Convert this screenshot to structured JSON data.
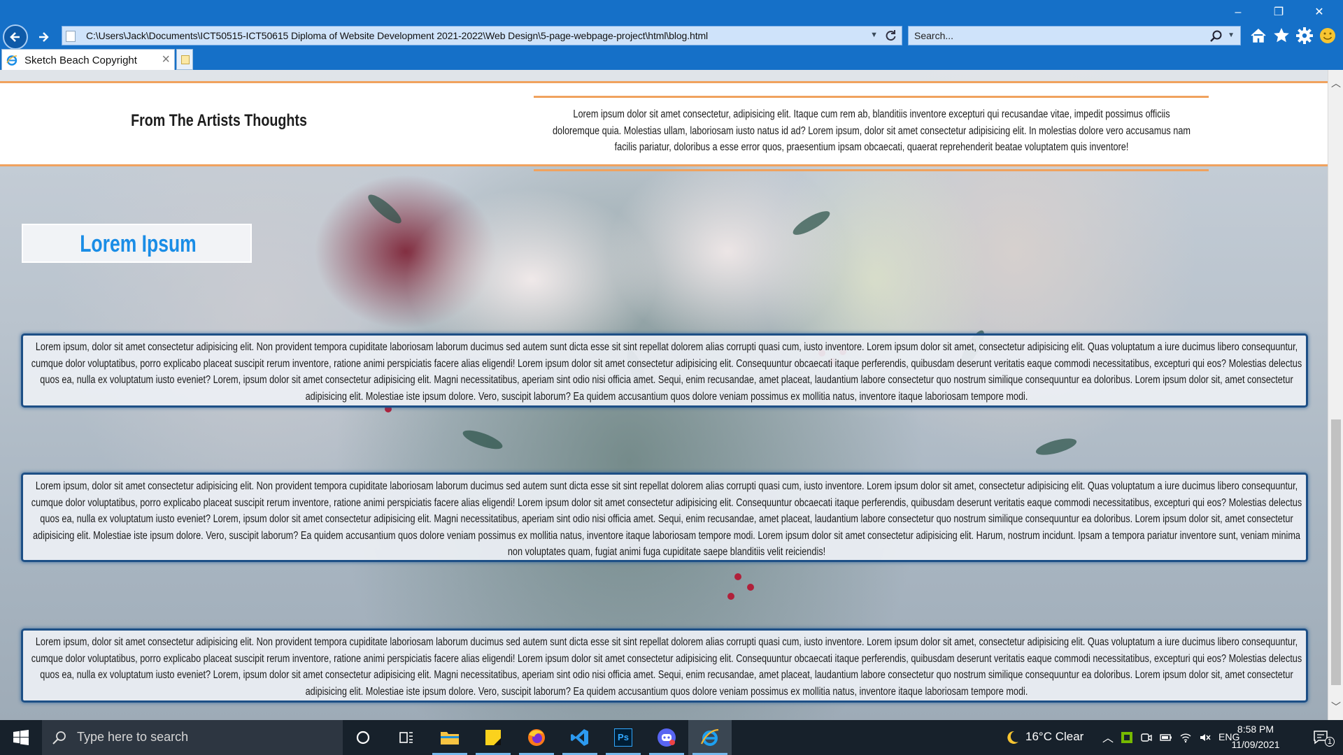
{
  "browser": {
    "address_url": "C:\\Users\\Jack\\Documents\\ICT50515-ICT50615 Diploma of Website Development 2021-2022\\Web Design\\5-page-webpage-project\\html\\blog.html",
    "search_placeholder": "Search...",
    "tab_title": "Sketch Beach Copyright",
    "tab_close": "×",
    "minimize": "–",
    "restore": "❐",
    "close": "✕",
    "dropdown": "▼"
  },
  "page": {
    "artist_heading": "From The Artists Thoughts",
    "artist_text": "Lorem ipsum dolor sit amet consectetur, adipisicing elit. Itaque cum rem ab, blanditiis inventore excepturi qui recusandae vitae, impedit possimus officiis doloremque quia. Molestias ullam, laboriosam iusto natus id ad? Lorem ipsum, dolor sit amet consectetur adipisicing elit. In molestias dolore vero accusamus nam facilis pariatur, doloribus a esse error quos, praesentium ipsam obcaecati, quaerat reprehenderit beatae voluptatem quis inventore!",
    "lorem_heading": "Lorem Ipsum",
    "cards": [
      "Lorem ipsum, dolor sit amet consectetur adipisicing elit. Non provident tempora cupiditate laboriosam laborum ducimus sed autem sunt dicta esse sit sint repellat dolorem alias corrupti quasi cum, iusto inventore. Lorem ipsum dolor sit amet, consectetur adipisicing elit. Quas voluptatum a iure ducimus libero consequuntur, cumque dolor voluptatibus, porro explicabo placeat suscipit rerum inventore, ratione animi perspiciatis facere alias eligendi! Lorem ipsum dolor sit amet consectetur adipisicing elit. Consequuntur obcaecati itaque perferendis, quibusdam deserunt veritatis eaque commodi necessitatibus, excepturi qui eos? Molestias delectus quos ea, nulla ex voluptatum iusto eveniet? Lorem, ipsum dolor sit amet consectetur adipisicing elit. Magni necessitatibus, aperiam sint odio nisi officia amet. Sequi, enim recusandae, amet placeat, laudantium labore consectetur quo nostrum similique consequuntur ea doloribus. Lorem ipsum dolor sit, amet consectetur adipisicing elit. Molestiae iste ipsum dolore. Vero, suscipit laborum? Ea quidem accusantium quos dolore veniam possimus ex mollitia natus, inventore itaque laboriosam tempore modi.",
      "Lorem ipsum, dolor sit amet consectetur adipisicing elit. Non provident tempora cupiditate laboriosam laborum ducimus sed autem sunt dicta esse sit sint repellat dolorem alias corrupti quasi cum, iusto inventore. Lorem ipsum dolor sit amet, consectetur adipisicing elit. Quas voluptatum a iure ducimus libero consequuntur, cumque dolor voluptatibus, porro explicabo placeat suscipit rerum inventore, ratione animi perspiciatis facere alias eligendi! Lorem ipsum dolor sit amet consectetur adipisicing elit. Consequuntur obcaecati itaque perferendis, quibusdam deserunt veritatis eaque commodi necessitatibus, excepturi qui eos? Molestias delectus quos ea, nulla ex voluptatum iusto eveniet? Lorem, ipsum dolor sit amet consectetur adipisicing elit. Magni necessitatibus, aperiam sint odio nisi officia amet. Sequi, enim recusandae, amet placeat, laudantium labore consectetur quo nostrum similique consequuntur ea doloribus. Lorem ipsum dolor sit, amet consectetur adipisicing elit. Molestiae iste ipsum dolore. Vero, suscipit laborum? Ea quidem accusantium quos dolore veniam possimus ex mollitia natus, inventore itaque laboriosam tempore modi. Lorem ipsum dolor sit amet consectetur adipisicing elit. Harum, nostrum incidunt. Ipsam a tempora pariatur inventore sunt, veniam minima non voluptates quam, fugiat animi fuga cupiditate saepe blanditiis velit reiciendis!",
      "Lorem ipsum, dolor sit amet consectetur adipisicing elit. Non provident tempora cupiditate laboriosam laborum ducimus sed autem sunt dicta esse sit sint repellat dolorem alias corrupti quasi cum, iusto inventore. Lorem ipsum dolor sit amet, consectetur adipisicing elit. Quas voluptatum a iure ducimus libero consequuntur, cumque dolor voluptatibus, porro explicabo placeat suscipit rerum inventore, ratione animi perspiciatis facere alias eligendi! Lorem ipsum dolor sit amet consectetur adipisicing elit. Consequuntur obcaecati itaque perferendis, quibusdam deserunt veritatis eaque commodi necessitatibus, excepturi qui eos? Molestias delectus quos ea, nulla ex voluptatum iusto eveniet? Lorem, ipsum dolor sit amet consectetur adipisicing elit. Magni necessitatibus, aperiam sint odio nisi officia amet. Sequi, enim recusandae, amet placeat, laudantium labore consectetur quo nostrum similique consequuntur ea doloribus. Lorem ipsum dolor sit, amet consectetur adipisicing elit. Molestiae iste ipsum dolore. Vero, suscipit laborum? Ea quidem accusantium quos dolore veniam possimus ex mollitia natus, inventore itaque laboriosam tempore modi."
    ]
  },
  "taskbar": {
    "search_label": "Type here to search",
    "weather": "16°C  Clear",
    "language": "ENG",
    "time": "8:58 PM",
    "date": "11/09/2021",
    "apps": [
      "cortana-icon",
      "task-view-icon",
      "file-explorer-icon",
      "sticky-notes-icon",
      "firefox-icon",
      "vscode-icon",
      "photoshop-icon",
      "discord-icon",
      "internet-explorer-icon"
    ],
    "photoshop_label": "Ps",
    "notification_count": "1"
  },
  "colors": {
    "chrome_blue": "#1570c8",
    "accent_orange": "#f0a25e",
    "heading_blue": "#1a8de6",
    "card_border": "#1d4f86",
    "taskbar": "#17212b"
  }
}
